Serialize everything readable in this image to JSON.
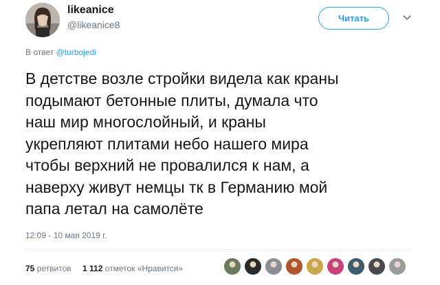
{
  "user": {
    "name": "likeanice",
    "handle": "@likeanice8"
  },
  "follow_button": {
    "label": "Читать"
  },
  "reply": {
    "prefix": "В ответ",
    "handle": "@turbojedi"
  },
  "tweet": {
    "lines": [
      "В детстве возле стройки видела как краны",
      "подымают бетонные плиты, думала что",
      "наш мир многослойный, и краны",
      "укрепляют плитами небо нашего мира",
      "чтобы верхний не провалился к нам, а",
      "наверху живут немцы тк в Германию мой",
      "папа летал на самолёте"
    ]
  },
  "timestamp": "12:09 - 10 мая 2019 г.",
  "stats": {
    "retweets_count": "75",
    "retweets_label": "ретвитов",
    "likes_count": "1 112",
    "likes_label": "отметок «Нравится»"
  },
  "likers": [
    {
      "icon": "liker-avatar",
      "color": "#6b7a5a"
    },
    {
      "icon": "liker-avatar",
      "color": "#2b2b2b"
    },
    {
      "icon": "liker-avatar",
      "color": "#8a8f95"
    },
    {
      "icon": "liker-avatar",
      "color": "#b0562f"
    },
    {
      "icon": "liker-avatar",
      "color": "#c9a64a"
    },
    {
      "icon": "liker-avatar",
      "color": "#c7447a"
    },
    {
      "icon": "liker-avatar",
      "color": "#3d5c6e"
    },
    {
      "icon": "liker-avatar",
      "color": "#4a4a4a"
    },
    {
      "icon": "liker-avatar",
      "color": "#9c9c9c"
    }
  ],
  "colors": {
    "accent": "#1da1f2",
    "text": "#14171a",
    "muted": "#657786"
  }
}
